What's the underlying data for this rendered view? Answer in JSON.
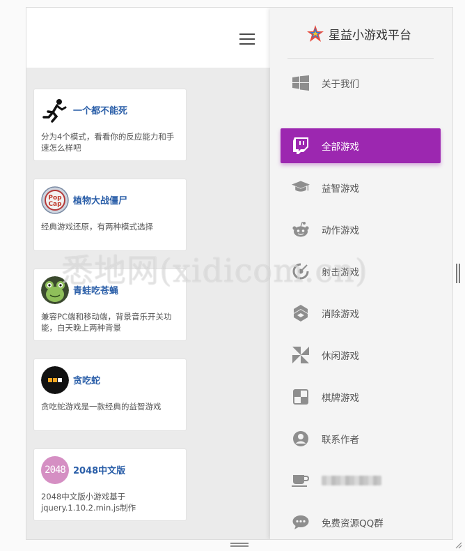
{
  "app": {
    "brand_name": "星益小游戏平台",
    "brand_icon": "star-logo-icon",
    "accent_color": "#9c27b0",
    "menu_icon": "hamburger-menu-icon"
  },
  "games": [
    {
      "title": "一个都不能死",
      "description": "分为4个模式，看看你的反应能力和手速怎么样吧",
      "icon": "running-stickman-icon"
    },
    {
      "title": "植物大战僵尸",
      "description": "经典游戏还原，有两种模式选择",
      "icon": "popcap-logo-icon"
    },
    {
      "title": "青蛙吃苍蝇",
      "description": "兼容PC端和移动端，背景音乐开关功能，白天晚上两种背景",
      "icon": "frog-icon"
    },
    {
      "title": "贪吃蛇",
      "description": "贪吃蛇游戏是一款经典的益智游戏",
      "icon": "snake-icon"
    },
    {
      "title": "2048中文版",
      "description": "2048中文版小游戏基于jquery.1.10.2.min.js制作",
      "icon": "2048-badge-icon",
      "icon_text": "2048"
    }
  ],
  "sidebar": {
    "items": [
      {
        "label": "关于我们",
        "icon": "windows-icon",
        "active": false
      },
      {
        "label": "全部游戏",
        "icon": "twitch-icon",
        "active": true
      },
      {
        "label": "益智游戏",
        "icon": "graduation-cap-icon",
        "active": false
      },
      {
        "label": "动作游戏",
        "icon": "reddit-alien-icon",
        "active": false
      },
      {
        "label": "射击游戏",
        "icon": "crosshair-icon",
        "active": false
      },
      {
        "label": "消除游戏",
        "icon": "hexagon-blocks-icon",
        "active": false
      },
      {
        "label": "休闲游戏",
        "icon": "pinwheel-icon",
        "active": false
      },
      {
        "label": "棋牌游戏",
        "icon": "board-squares-icon",
        "active": false
      },
      {
        "label": "联系作者",
        "icon": "user-circle-icon",
        "active": false
      },
      {
        "label": "",
        "icon": "coffee-cup-icon",
        "active": false,
        "blurred": true
      },
      {
        "label": "免费资源QQ群",
        "icon": "chat-bubble-icon",
        "active": false
      }
    ]
  },
  "watermark": {
    "text": "悉地网(xidicom.cn)"
  }
}
